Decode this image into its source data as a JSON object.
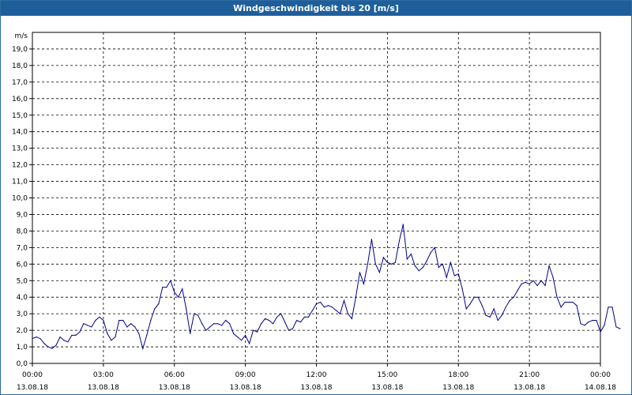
{
  "window": {
    "title": "Windgeschwindigkeit bis 20 [m/s]"
  },
  "chart_data": {
    "type": "line",
    "title": "Windgeschwindigkeit bis 20 [m/s]",
    "ylabel": "m/s",
    "xlabel": "",
    "ylim": [
      0,
      20
    ],
    "xlim": [
      0,
      24
    ],
    "grid": true,
    "line_color": "#00008b",
    "y_ticks": [
      "0,0",
      "1,0",
      "2,0",
      "3,0",
      "4,0",
      "5,0",
      "6,0",
      "7,0",
      "8,0",
      "9,0",
      "10,0",
      "11,0",
      "12,0",
      "13,0",
      "14,0",
      "15,0",
      "16,0",
      "17,0",
      "18,0",
      "19,0"
    ],
    "x_ticks": [
      {
        "time": "00:00",
        "date": "13.08.18",
        "hour": 0
      },
      {
        "time": "03:00",
        "date": "13.08.18",
        "hour": 3
      },
      {
        "time": "06:00",
        "date": "13.08.18",
        "hour": 6
      },
      {
        "time": "09:00",
        "date": "13.08.18",
        "hour": 9
      },
      {
        "time": "12:00",
        "date": "13.08.18",
        "hour": 12
      },
      {
        "time": "15:00",
        "date": "13.08.18",
        "hour": 15
      },
      {
        "time": "18:00",
        "date": "13.08.18",
        "hour": 18
      },
      {
        "time": "21:00",
        "date": "13.08.18",
        "hour": 21
      },
      {
        "time": "00:00",
        "date": "14.08.18",
        "hour": 24
      }
    ],
    "series": [
      {
        "interval_minutes": 10,
        "values": [
          1.5,
          1.6,
          1.5,
          1.2,
          1.0,
          0.9,
          1.1,
          1.6,
          1.4,
          1.3,
          1.7,
          1.7,
          1.9,
          2.4,
          2.3,
          2.2,
          2.6,
          2.8,
          2.6,
          1.8,
          1.4,
          1.6,
          2.6,
          2.6,
          2.2,
          2.4,
          2.2,
          1.8,
          0.9,
          1.7,
          2.6,
          3.3,
          3.6,
          4.6,
          4.6,
          5.0,
          4.3,
          4.0,
          4.5,
          3.3,
          1.8,
          3.0,
          2.9,
          2.4,
          2.0,
          2.2,
          2.4,
          2.4,
          2.3,
          2.6,
          2.4,
          1.8,
          1.6,
          1.4,
          1.7,
          1.2,
          2.0,
          1.9,
          2.4,
          2.7,
          2.6,
          2.4,
          2.8,
          3.0,
          2.5,
          2.0,
          2.1,
          2.6,
          2.5,
          2.8,
          2.8,
          3.2,
          3.6,
          3.7,
          3.4,
          3.5,
          3.4,
          3.2,
          3.0,
          3.8,
          3.0,
          2.7,
          4.0,
          5.5,
          4.8,
          6.0,
          7.5,
          6.0,
          5.5,
          6.4,
          6.1,
          6.0,
          6.1,
          7.4,
          8.4,
          6.3,
          6.6,
          5.9,
          5.6,
          5.8,
          6.2,
          6.7,
          7.0,
          5.8,
          6.0,
          5.2,
          6.1,
          5.3,
          5.4,
          4.5,
          3.3,
          3.6,
          4.0,
          4.0,
          3.5,
          2.9,
          2.8,
          3.3,
          2.6,
          2.9,
          3.4,
          3.8,
          4.0,
          4.4,
          4.8,
          4.9,
          4.8,
          5.0,
          4.7,
          5.0,
          4.7,
          5.9,
          5.2,
          4.0,
          3.4,
          3.7,
          3.7,
          3.7,
          3.5,
          2.4,
          2.3,
          2.5,
          2.6,
          2.6,
          1.9,
          2.3,
          3.4,
          3.4,
          2.2,
          2.1
        ]
      }
    ]
  }
}
